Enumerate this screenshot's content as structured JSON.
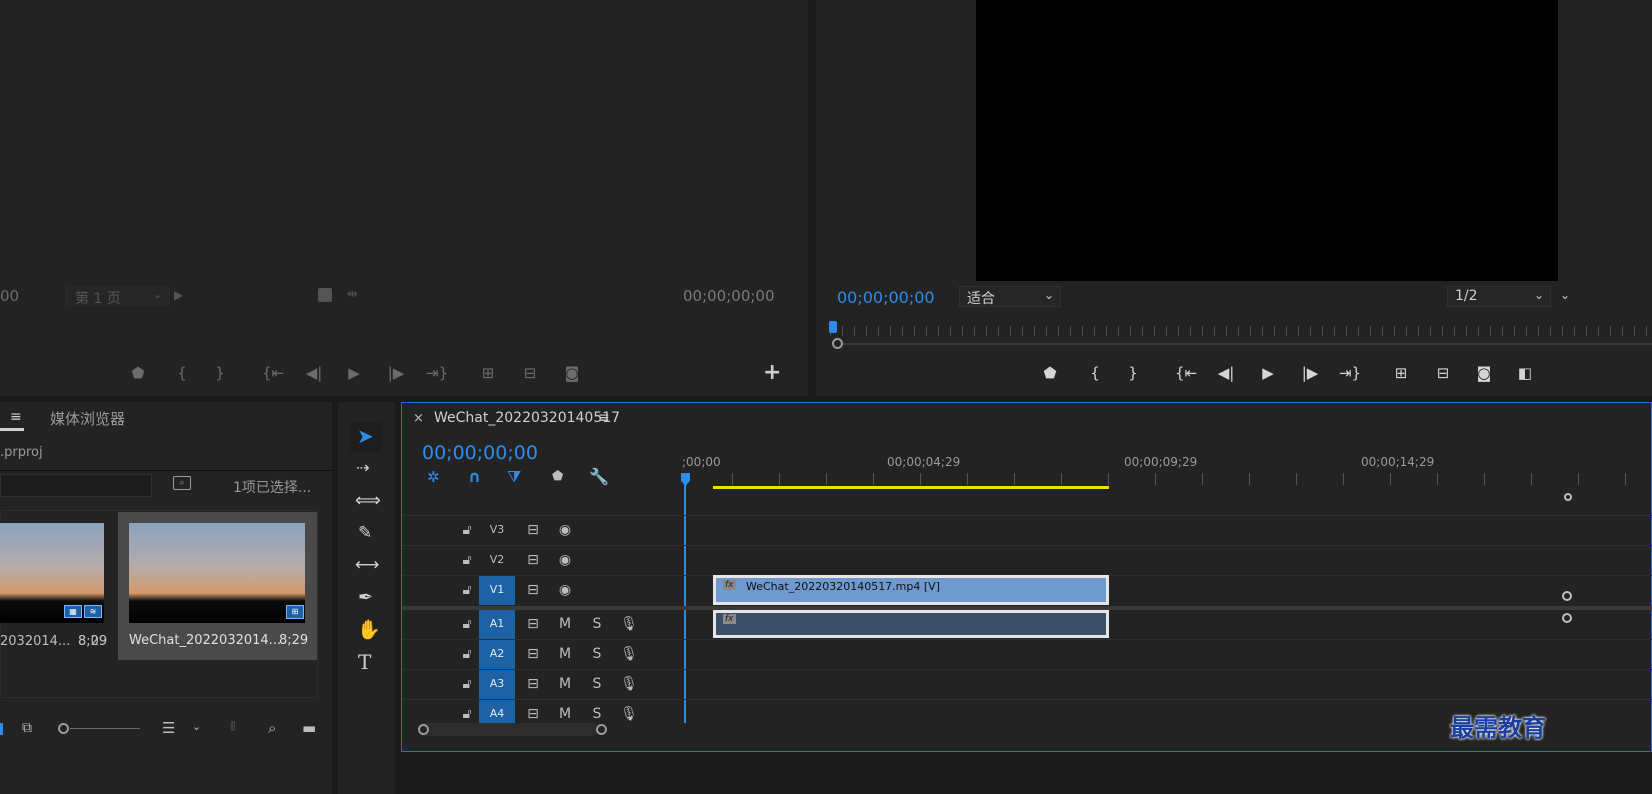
{
  "source_monitor": {
    "timecode_left": "00",
    "page_select": "第 1 页",
    "timecode_right": "00;00;00;00",
    "controls": [
      "marker-icon",
      "in-icon",
      "out-icon",
      "go-in-icon",
      "step-back-icon",
      "play-icon",
      "step-forward-icon",
      "go-out-icon",
      "insert-icon",
      "overwrite-icon",
      "camera-icon"
    ],
    "add_button": "+"
  },
  "program_monitor": {
    "timecode": "00;00;00;00",
    "fit_select": "适合",
    "resolution_select": "1/2"
  },
  "project_panel": {
    "tab_menu": "≡",
    "tab_media_browser": "媒体浏览器",
    "project_file": ".prproj",
    "selection_status": "1项已选择...",
    "items": [
      {
        "name": "2032014...",
        "duration": "8;09"
      },
      {
        "name": "WeChat_2022032014...",
        "duration": "8;29"
      }
    ]
  },
  "timeline": {
    "close": "×",
    "sequence_name": "WeChat_20220320140517",
    "menu": "≡",
    "timecode": "00;00;00;00",
    "ruler": [
      ";00;00",
      "00;00;04;29",
      "00;00;09;29",
      "00;00;14;29"
    ],
    "video_tracks": [
      "V3",
      "V2",
      "V1"
    ],
    "audio_tracks": [
      "A1",
      "A2",
      "A3",
      "A4"
    ],
    "mute": "M",
    "solo": "S",
    "video_clip_label": "WeChat_20220320140517.mp4 [V]",
    "fx": "fx"
  },
  "watermark": "最需教育"
}
